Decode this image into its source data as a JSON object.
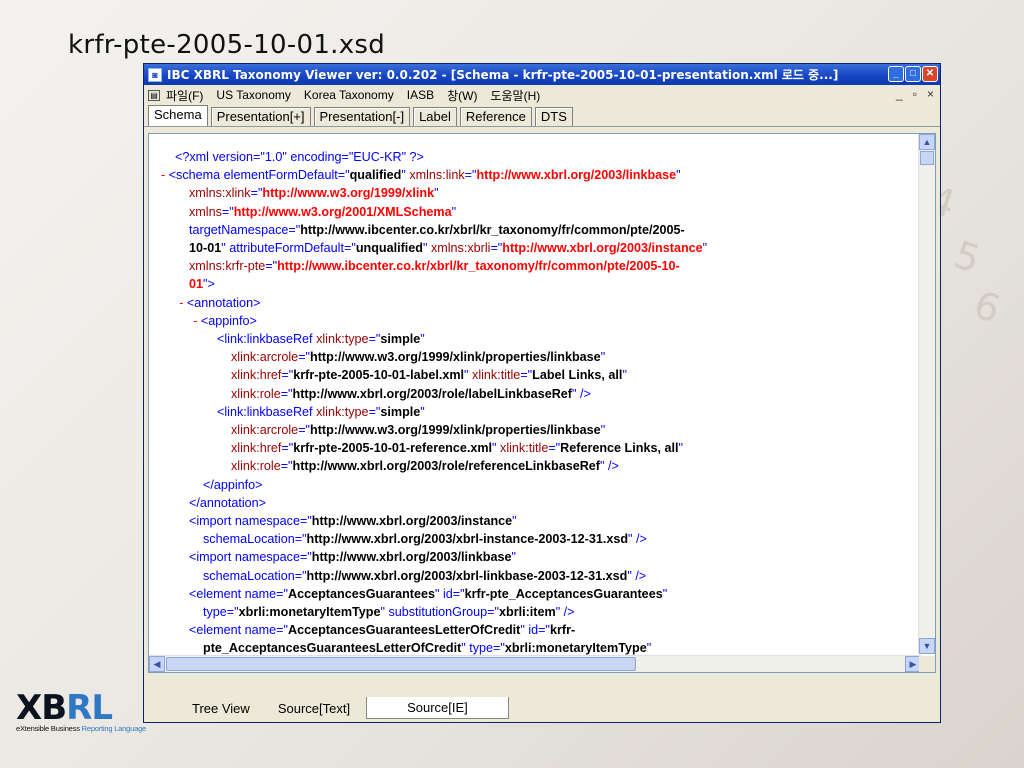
{
  "slide": {
    "title": "krfr-pte-2005-10-01.xsd"
  },
  "window": {
    "title": "IBC XBRL Taxonomy Viewer ver: 0.0.202 - [Schema - krfr-pte-2005-10-01-presentation.xml 로드 중...]",
    "controls": {
      "minimize": "_",
      "maximize": "□",
      "close": "✕"
    }
  },
  "menu": {
    "items": [
      "파일(F)",
      "US Taxonomy",
      "Korea Taxonomy",
      "IASB",
      "창(W)",
      "도움말(H)"
    ],
    "mdi_controls": [
      "_",
      "▫",
      "×"
    ]
  },
  "tabs": [
    "Schema",
    "Presentation[+]",
    "Presentation[-]",
    "Label",
    "Reference",
    "DTS"
  ],
  "active_tab": "Schema",
  "bottom_tabs": [
    "Tree View",
    "Source[Text]",
    "Source[IE]"
  ],
  "active_bottom_tab": "Source[IE]",
  "xml_lines": [
    {
      "indent": 0,
      "segs": [
        [
          "t",
          "<?xml version=\"1.0\" encoding=\"EUC-KR\" ?>"
        ]
      ]
    },
    {
      "indent": -1,
      "segs": [
        [
          "m",
          "- "
        ],
        [
          "t",
          "<schema elementFormDefault=\""
        ],
        [
          "b",
          "qualified"
        ],
        [
          "t",
          "\" "
        ],
        [
          "a",
          "xmlns:link"
        ],
        [
          "t",
          "=\""
        ],
        [
          "r",
          "http://www.xbrl.org/2003/linkbase"
        ],
        [
          "t",
          "\""
        ]
      ]
    },
    {
      "indent": 1,
      "segs": [
        [
          "a",
          "xmlns:xlink"
        ],
        [
          "t",
          "=\""
        ],
        [
          "r",
          "http://www.w3.org/1999/xlink"
        ],
        [
          "t",
          "\""
        ]
      ]
    },
    {
      "indent": 1,
      "segs": [
        [
          "a",
          "xmlns"
        ],
        [
          "t",
          "=\""
        ],
        [
          "r",
          "http://www.w3.org/2001/XMLSchema"
        ],
        [
          "t",
          "\""
        ]
      ]
    },
    {
      "indent": 1,
      "segs": [
        [
          "t",
          "targetNamespace=\""
        ],
        [
          "b",
          "http://www.ibcenter.co.kr/xbrl/kr_taxonomy/fr/common/pte/2005-"
        ]
      ]
    },
    {
      "indent": 1,
      "segs": [
        [
          "b",
          "10-01"
        ],
        [
          "t",
          "\" attributeFormDefault=\""
        ],
        [
          "b",
          "unqualified"
        ],
        [
          "t",
          "\" "
        ],
        [
          "a",
          "xmlns:xbrli"
        ],
        [
          "t",
          "=\""
        ],
        [
          "r",
          "http://www.xbrl.org/2003/instance"
        ],
        [
          "t",
          "\""
        ]
      ]
    },
    {
      "indent": 1,
      "segs": [
        [
          "a",
          "xmlns:krfr-pte"
        ],
        [
          "t",
          "=\""
        ],
        [
          "r",
          "http://www.ibcenter.co.kr/xbrl/kr_taxonomy/fr/common/pte/2005-10-"
        ]
      ]
    },
    {
      "indent": 1,
      "segs": [
        [
          "r",
          "01"
        ],
        [
          "t",
          "\">"
        ]
      ]
    },
    {
      "indent": 0.3,
      "segs": [
        [
          "m",
          "- "
        ],
        [
          "t",
          "<annotation>"
        ]
      ]
    },
    {
      "indent": 1.3,
      "segs": [
        [
          "m",
          "- "
        ],
        [
          "t",
          "<appinfo>"
        ]
      ]
    },
    {
      "indent": 3,
      "segs": [
        [
          "t",
          "<link:linkbaseRef "
        ],
        [
          "a",
          "xlink:type"
        ],
        [
          "t",
          "=\""
        ],
        [
          "b",
          "simple"
        ],
        [
          "t",
          "\""
        ]
      ]
    },
    {
      "indent": 4,
      "segs": [
        [
          "a",
          "xlink:arcrole"
        ],
        [
          "t",
          "=\""
        ],
        [
          "b",
          "http://www.w3.org/1999/xlink/properties/linkbase"
        ],
        [
          "t",
          "\""
        ]
      ]
    },
    {
      "indent": 4,
      "segs": [
        [
          "a",
          "xlink:href"
        ],
        [
          "t",
          "=\""
        ],
        [
          "b",
          "krfr-pte-2005-10-01-label.xml"
        ],
        [
          "t",
          "\" "
        ],
        [
          "a",
          "xlink:title"
        ],
        [
          "t",
          "=\""
        ],
        [
          "b",
          "Label Links, all"
        ],
        [
          "t",
          "\""
        ]
      ]
    },
    {
      "indent": 4,
      "segs": [
        [
          "a",
          "xlink:role"
        ],
        [
          "t",
          "=\""
        ],
        [
          "b",
          "http://www.xbrl.org/2003/role/labelLinkbaseRef"
        ],
        [
          "t",
          "\" />"
        ]
      ]
    },
    {
      "indent": 3,
      "segs": [
        [
          "t",
          "<link:linkbaseRef "
        ],
        [
          "a",
          "xlink:type"
        ],
        [
          "t",
          "=\""
        ],
        [
          "b",
          "simple"
        ],
        [
          "t",
          "\""
        ]
      ]
    },
    {
      "indent": 4,
      "segs": [
        [
          "a",
          "xlink:arcrole"
        ],
        [
          "t",
          "=\""
        ],
        [
          "b",
          "http://www.w3.org/1999/xlink/properties/linkbase"
        ],
        [
          "t",
          "\""
        ]
      ]
    },
    {
      "indent": 4,
      "segs": [
        [
          "a",
          "xlink:href"
        ],
        [
          "t",
          "=\""
        ],
        [
          "b",
          "krfr-pte-2005-10-01-reference.xml"
        ],
        [
          "t",
          "\" "
        ],
        [
          "a",
          "xlink:title"
        ],
        [
          "t",
          "=\""
        ],
        [
          "b",
          "Reference Links, all"
        ],
        [
          "t",
          "\""
        ]
      ]
    },
    {
      "indent": 4,
      "segs": [
        [
          "a",
          "xlink:role"
        ],
        [
          "t",
          "=\""
        ],
        [
          "b",
          "http://www.xbrl.org/2003/role/referenceLinkbaseRef"
        ],
        [
          "t",
          "\" />"
        ]
      ]
    },
    {
      "indent": 2,
      "segs": [
        [
          "t",
          "</appinfo>"
        ]
      ]
    },
    {
      "indent": 1,
      "segs": [
        [
          "t",
          "</annotation>"
        ]
      ]
    },
    {
      "indent": 1,
      "segs": [
        [
          "t",
          "<import namespace=\""
        ],
        [
          "b",
          "http://www.xbrl.org/2003/instance"
        ],
        [
          "t",
          "\""
        ]
      ]
    },
    {
      "indent": 2,
      "segs": [
        [
          "t",
          "schemaLocation=\""
        ],
        [
          "b",
          "http://www.xbrl.org/2003/xbrl-instance-2003-12-31.xsd"
        ],
        [
          "t",
          "\" />"
        ]
      ]
    },
    {
      "indent": 1,
      "segs": [
        [
          "t",
          "<import namespace=\""
        ],
        [
          "b",
          "http://www.xbrl.org/2003/linkbase"
        ],
        [
          "t",
          "\""
        ]
      ]
    },
    {
      "indent": 2,
      "segs": [
        [
          "t",
          "schemaLocation=\""
        ],
        [
          "b",
          "http://www.xbrl.org/2003/xbrl-linkbase-2003-12-31.xsd"
        ],
        [
          "t",
          "\" />"
        ]
      ]
    },
    {
      "indent": 1,
      "segs": [
        [
          "t",
          "<element name=\""
        ],
        [
          "b",
          "AcceptancesGuarantees"
        ],
        [
          "t",
          "\" id=\""
        ],
        [
          "b",
          "krfr-pte_AcceptancesGuarantees"
        ],
        [
          "t",
          "\""
        ]
      ]
    },
    {
      "indent": 2,
      "segs": [
        [
          "t",
          "type=\""
        ],
        [
          "b",
          "xbrli:monetaryItemType"
        ],
        [
          "t",
          "\" substitutionGroup=\""
        ],
        [
          "b",
          "xbrli:item"
        ],
        [
          "t",
          "\" />"
        ]
      ]
    },
    {
      "indent": 1,
      "segs": [
        [
          "t",
          "<element name=\""
        ],
        [
          "b",
          "AcceptancesGuaranteesLetterOfCredit"
        ],
        [
          "t",
          "\" id=\""
        ],
        [
          "b",
          "krfr-"
        ]
      ]
    },
    {
      "indent": 2,
      "segs": [
        [
          "b",
          "pte_AcceptancesGuaranteesLetterOfCredit"
        ],
        [
          "t",
          "\" type=\""
        ],
        [
          "b",
          "xbrli:monetaryItemType"
        ],
        [
          "t",
          "\""
        ]
      ]
    }
  ],
  "logo": {
    "main_left": "XB",
    "main_right": "RL",
    "sub_left": "eXtensible Business",
    "sub_right": "Reporting Language"
  }
}
